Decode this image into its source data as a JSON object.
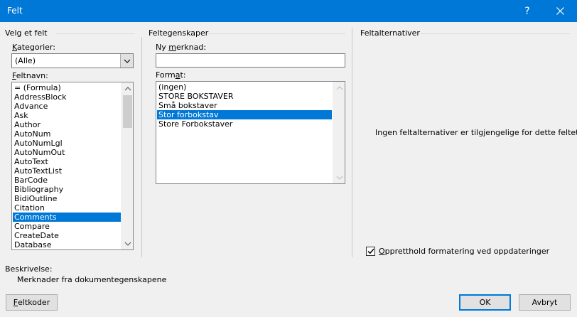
{
  "window": {
    "title": "Felt",
    "help_label": "?",
    "close_label": "✕"
  },
  "left": {
    "section_title": "Velg et felt",
    "categories_label_u": "K",
    "categories_label_rest": "ategorier:",
    "category_selected": "(Alle)",
    "fieldnames_label_u": "F",
    "fieldnames_label_rest": "eltnavn:",
    "field_names": [
      {
        "label": "= (Formula)"
      },
      {
        "label": "AddressBlock"
      },
      {
        "label": "Advance"
      },
      {
        "label": "Ask"
      },
      {
        "label": "Author"
      },
      {
        "label": "AutoNum"
      },
      {
        "label": "AutoNumLgl"
      },
      {
        "label": "AutoNumOut"
      },
      {
        "label": "AutoText"
      },
      {
        "label": "AutoTextList"
      },
      {
        "label": "BarCode"
      },
      {
        "label": "Bibliography"
      },
      {
        "label": "BidiOutline"
      },
      {
        "label": "Citation"
      },
      {
        "label": "Comments",
        "selected": true
      },
      {
        "label": "Compare"
      },
      {
        "label": "CreateDate"
      },
      {
        "label": "Database"
      }
    ]
  },
  "middle": {
    "section_title": "Feltegenskaper",
    "new_comment_label_pre": "Ny ",
    "new_comment_label_u": "m",
    "new_comment_label_rest": "erknad:",
    "new_comment_value": "",
    "format_label_pre": "Form",
    "format_label_u": "a",
    "format_label_rest": "t:",
    "formats": [
      {
        "label": "(ingen)"
      },
      {
        "label": "STORE BOKSTAVER"
      },
      {
        "label": "Små bokstaver"
      },
      {
        "label": "Stor forbokstav",
        "selected": true
      },
      {
        "label": "Store Forbokstaver"
      }
    ]
  },
  "right": {
    "section_title": "Feltalternativer",
    "no_options_text": "Ingen feltalternativer er tilgjengelige for dette feltet",
    "preserve_checked": true,
    "preserve_label": "Oppretthold formatering ved oppdateringer",
    "preserve_label_u": "O",
    "preserve_label_rest": "ppretthold formatering ved oppdateringer"
  },
  "description": {
    "label": "Beskrivelse:",
    "text": "Merknader fra dokumentegenskapene"
  },
  "buttons": {
    "field_codes_u": "F",
    "field_codes_rest": "eltkoder",
    "ok": "OK",
    "cancel": "Avbryt"
  },
  "colors": {
    "accent": "#0078d7",
    "dialog_bg": "#f0f0f0"
  }
}
